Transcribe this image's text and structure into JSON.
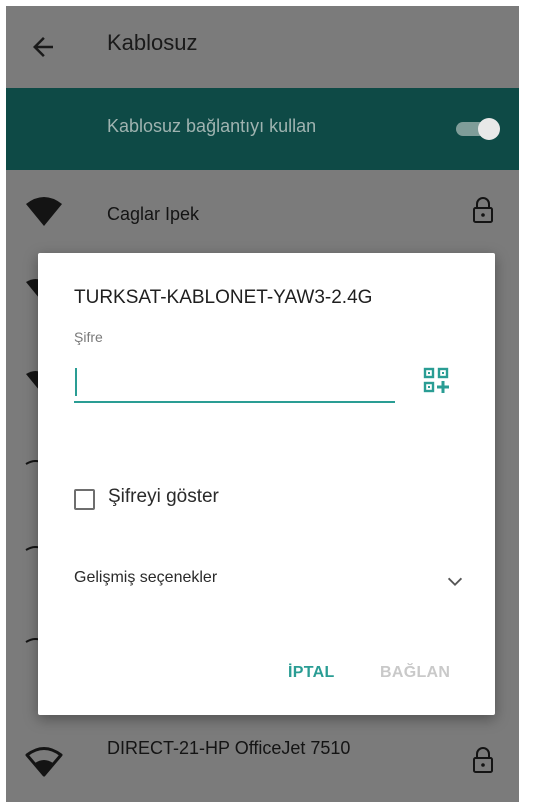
{
  "appbar": {
    "title": "Kablosuz",
    "back_icon": "arrow-back-icon"
  },
  "master_switch": {
    "label": "Kablosuz bağlantıyı kullan",
    "state": "on"
  },
  "networks": [
    {
      "name": "Caglar Ipek",
      "secured": true
    },
    {
      "name": "DIRECT-21-HP OfficeJet 7510",
      "secured": true
    }
  ],
  "dialog": {
    "title": "TURKSAT-KABLONET-YAW3-2.4G",
    "password_label": "Şifre",
    "password_value": "",
    "qr_icon": "qr-code-add-icon",
    "show_password_label": "Şifreyi göster",
    "show_password_checked": false,
    "advanced_label": "Gelişmiş seçenekler",
    "cancel_label": "İPTAL",
    "connect_label": "BAĞLAN"
  },
  "colors": {
    "accent": "#2a9d94",
    "master_bg": "#0e4a46",
    "scrim": "#7b7b7b",
    "disabled_text": "#c9c9c9"
  }
}
